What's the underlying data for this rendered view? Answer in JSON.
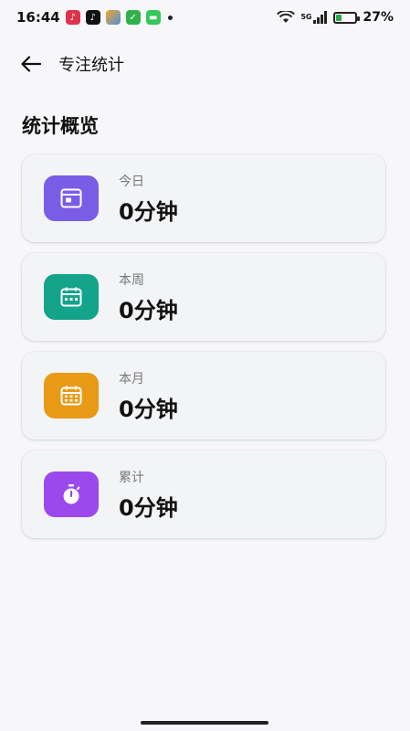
{
  "status_bar": {
    "time": "16:44",
    "network": "5G",
    "battery_percent": "27%",
    "battery_level": 0.27
  },
  "header": {
    "title": "专注统计"
  },
  "section_title": "统计概览",
  "cards": [
    {
      "label": "今日",
      "value": "0分钟",
      "icon": "calendar-icon",
      "color": "#7b5ce6"
    },
    {
      "label": "本周",
      "value": "0分钟",
      "icon": "calendar-week-icon",
      "color": "#14a38b"
    },
    {
      "label": "本月",
      "value": "0分钟",
      "icon": "calendar-month-icon",
      "color": "#e89a16"
    },
    {
      "label": "累计",
      "value": "0分钟",
      "icon": "stopwatch-icon",
      "color": "#9b49ec"
    }
  ]
}
